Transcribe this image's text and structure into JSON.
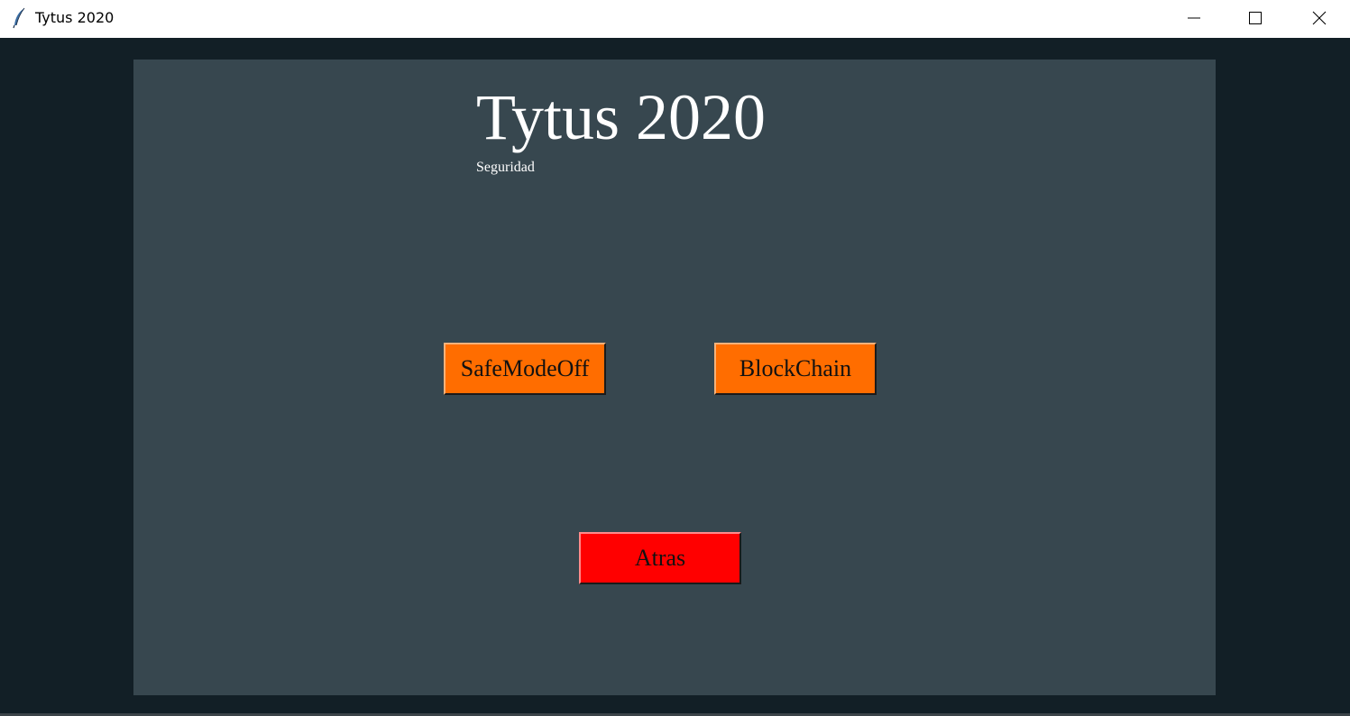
{
  "window": {
    "title": "Tytus 2020",
    "icon": "feather-icon"
  },
  "colors": {
    "background": "#121f26",
    "panel": "#37474f",
    "primary_button": "#ff6d00",
    "back_button": "#ff0000",
    "title_text": "#ffffff"
  },
  "header": {
    "title": "Tytus 2020",
    "subtitle": "Seguridad"
  },
  "buttons": {
    "safe_mode_off": "SafeModeOff",
    "blockchain": "BlockChain",
    "back": "Atras"
  }
}
